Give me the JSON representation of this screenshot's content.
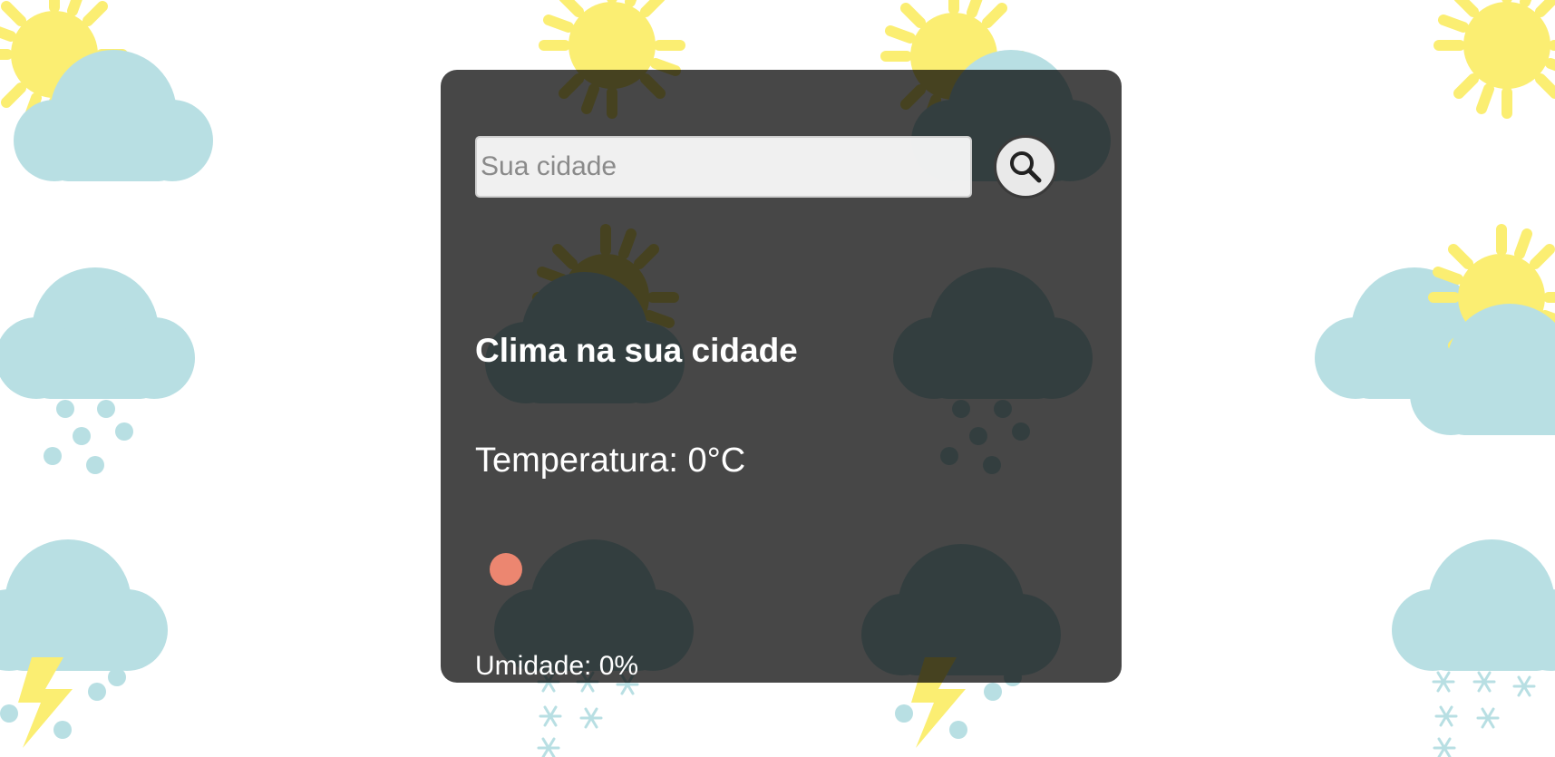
{
  "search": {
    "placeholder": "Sua cidade",
    "value": "",
    "button_icon": "search-icon"
  },
  "weather": {
    "title": "Clima na sua cidade",
    "temperature_label": "Temperatura:",
    "temperature_value": "0°C",
    "icon": "weather-icon",
    "humidity_label": "Umidade:",
    "humidity_value": "0%"
  },
  "background": {
    "pattern": "weather-icons-tiled",
    "icons": [
      "sun-cloud-icon",
      "sun-icon",
      "rain-cloud-icon",
      "storm-cloud-icon",
      "snow-cloud-icon"
    ]
  },
  "colors": {
    "card": "#000000b8",
    "sun": "#fbee72",
    "cloud": "#b8dfe3",
    "weather_icon": "#ec8670",
    "text": "#ffffff"
  }
}
